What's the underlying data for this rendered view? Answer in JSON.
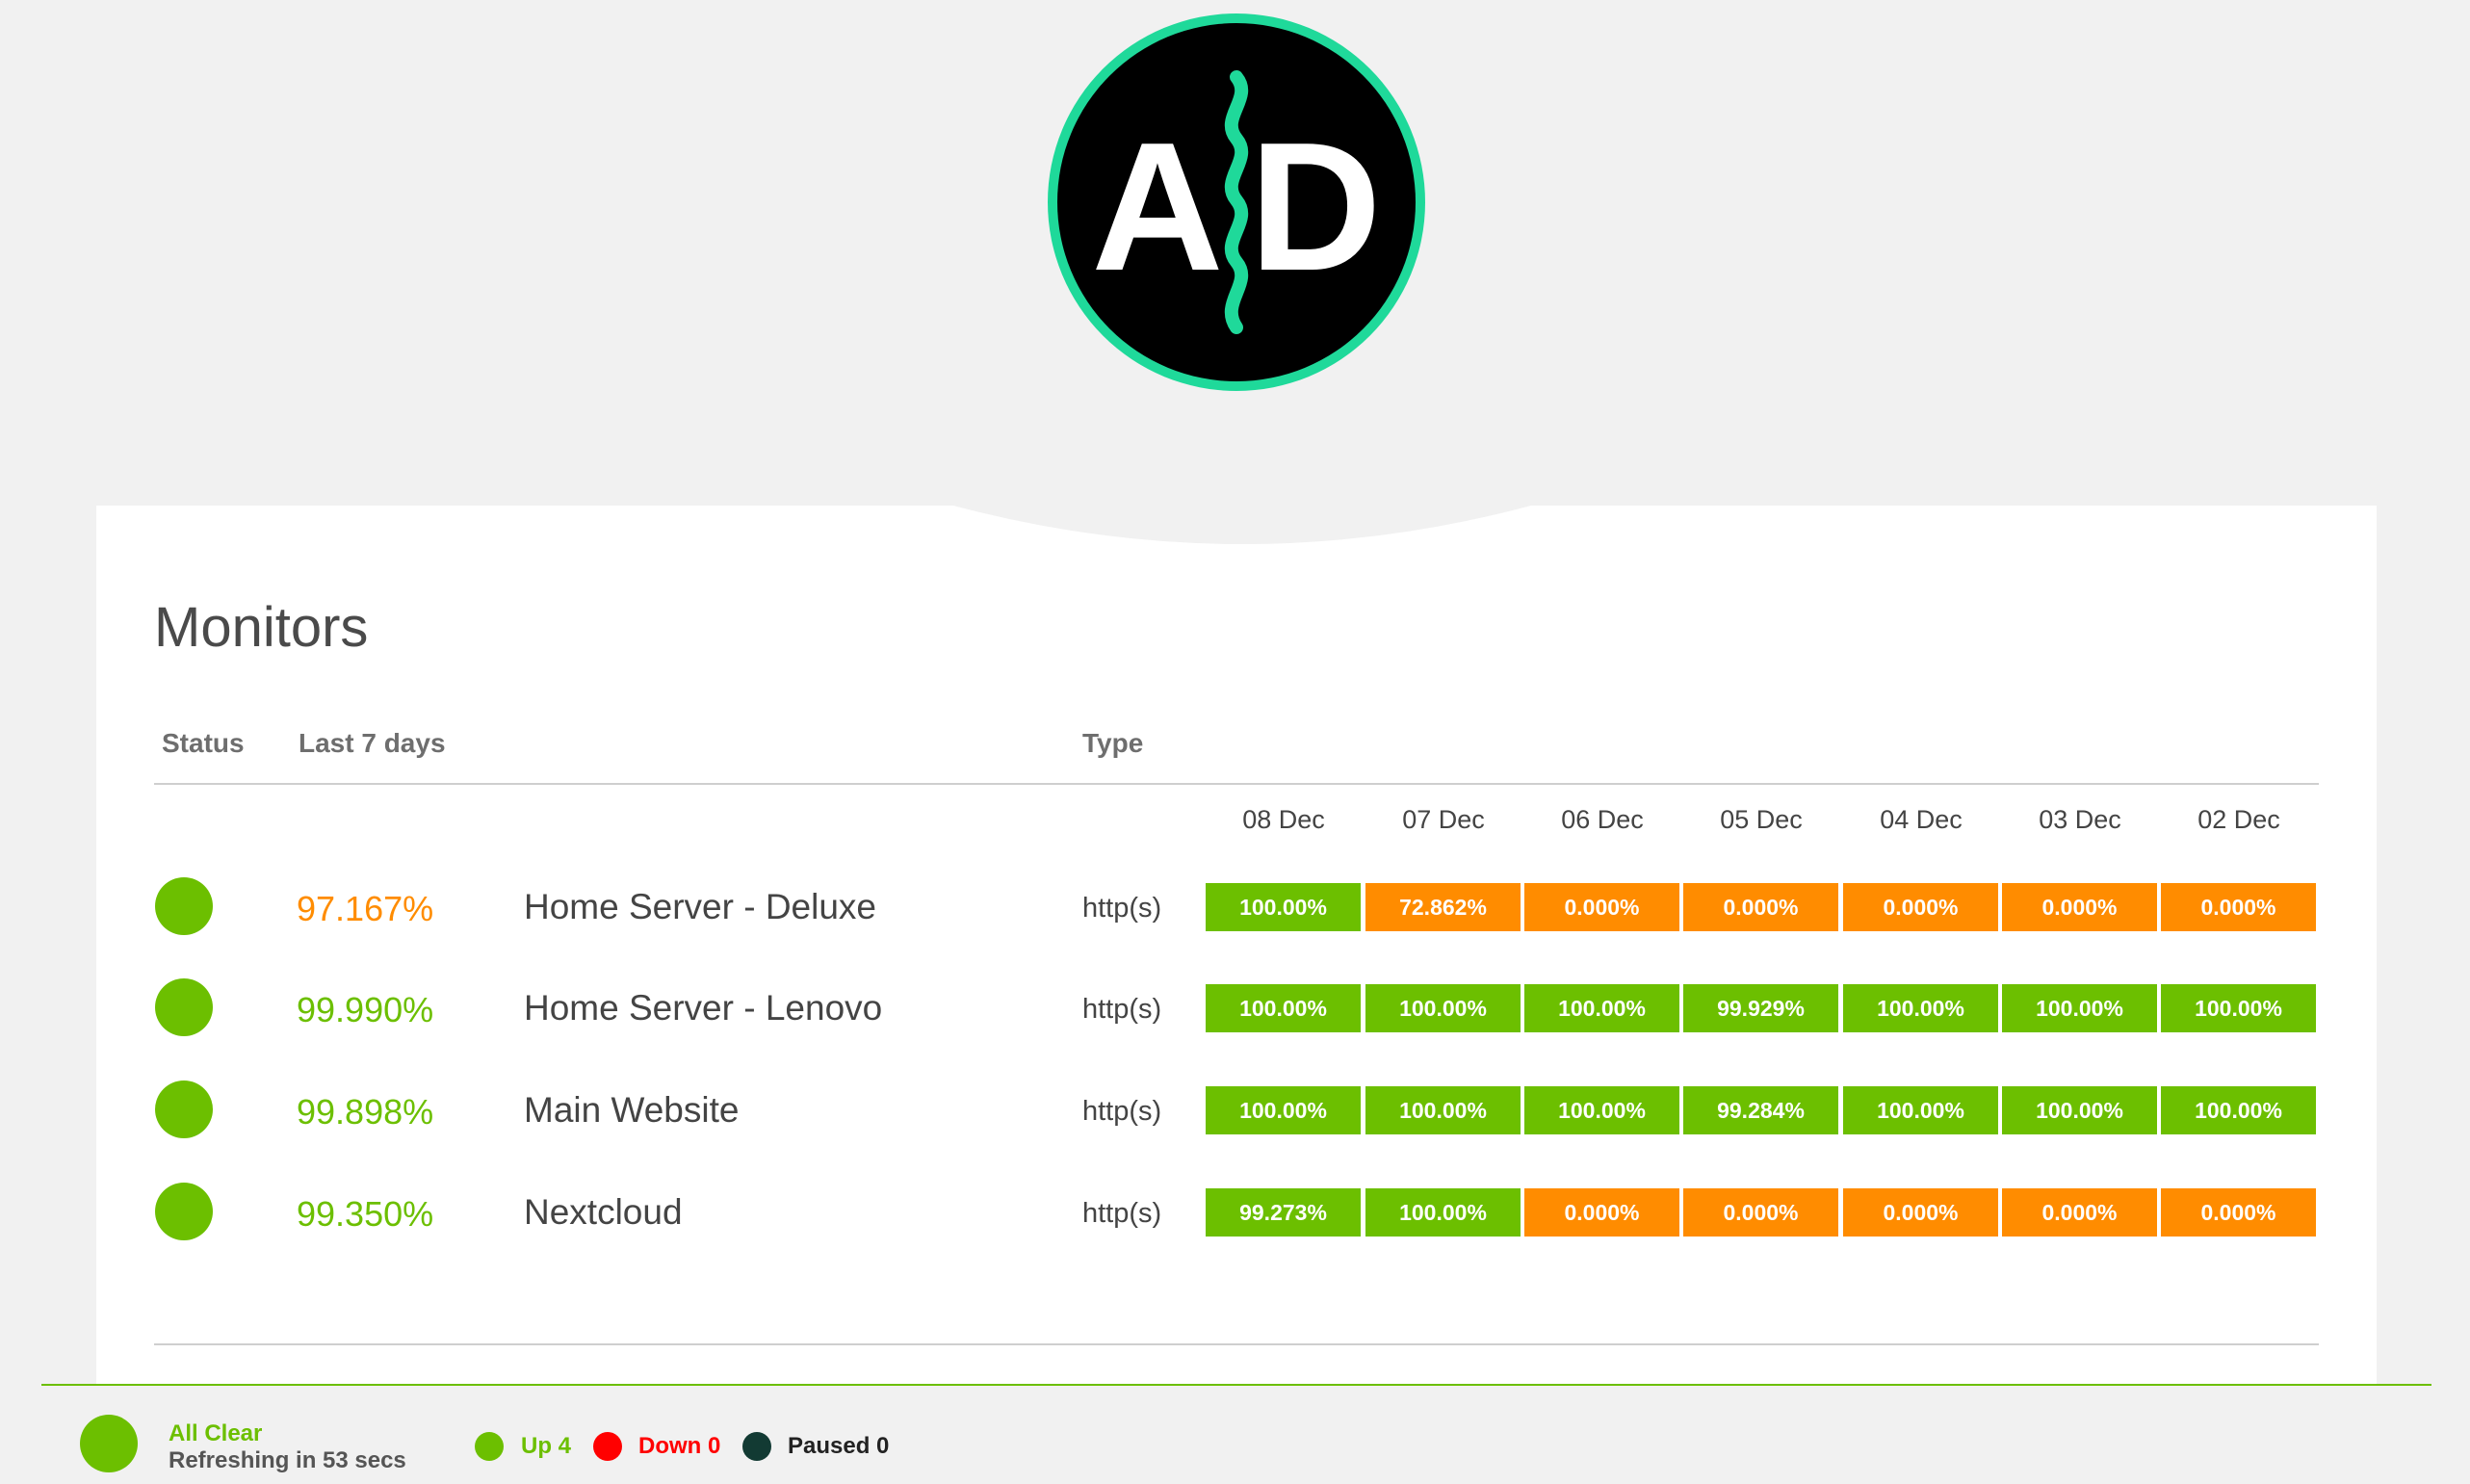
{
  "logo": {
    "text_left": "A",
    "text_right": "D",
    "ring_color": "#1fd99a",
    "bg_color": "#000000"
  },
  "colors": {
    "up": "#6cbf00",
    "warn": "#ff8c00",
    "down": "#ff0000",
    "paused": "#123a33"
  },
  "page_title": "Monitors",
  "table": {
    "headers": {
      "status": "Status",
      "last7": "Last 7 days",
      "type": "Type"
    },
    "dates": [
      "08 Dec",
      "07 Dec",
      "06 Dec",
      "05 Dec",
      "04 Dec",
      "03 Dec",
      "02 Dec"
    ],
    "rows": [
      {
        "status": "up",
        "uptime": "97.167%",
        "uptime_color": "#ff8c00",
        "name": "Home Server - Deluxe",
        "type": "http(s)",
        "days": [
          {
            "value": "100.00%",
            "status": "green"
          },
          {
            "value": "72.862%",
            "status": "orange"
          },
          {
            "value": "0.000%",
            "status": "orange"
          },
          {
            "value": "0.000%",
            "status": "orange"
          },
          {
            "value": "0.000%",
            "status": "orange"
          },
          {
            "value": "0.000%",
            "status": "orange"
          },
          {
            "value": "0.000%",
            "status": "orange"
          }
        ]
      },
      {
        "status": "up",
        "uptime": "99.990%",
        "uptime_color": "#6cbf00",
        "name": "Home Server - Lenovo",
        "type": "http(s)",
        "days": [
          {
            "value": "100.00%",
            "status": "green"
          },
          {
            "value": "100.00%",
            "status": "green"
          },
          {
            "value": "100.00%",
            "status": "green"
          },
          {
            "value": "99.929%",
            "status": "green"
          },
          {
            "value": "100.00%",
            "status": "green"
          },
          {
            "value": "100.00%",
            "status": "green"
          },
          {
            "value": "100.00%",
            "status": "green"
          }
        ]
      },
      {
        "status": "up",
        "uptime": "99.898%",
        "uptime_color": "#6cbf00",
        "name": "Main Website",
        "type": "http(s)",
        "days": [
          {
            "value": "100.00%",
            "status": "green"
          },
          {
            "value": "100.00%",
            "status": "green"
          },
          {
            "value": "100.00%",
            "status": "green"
          },
          {
            "value": "99.284%",
            "status": "green"
          },
          {
            "value": "100.00%",
            "status": "green"
          },
          {
            "value": "100.00%",
            "status": "green"
          },
          {
            "value": "100.00%",
            "status": "green"
          }
        ]
      },
      {
        "status": "up",
        "uptime": "99.350%",
        "uptime_color": "#6cbf00",
        "name": "Nextcloud",
        "type": "http(s)",
        "days": [
          {
            "value": "99.273%",
            "status": "green"
          },
          {
            "value": "100.00%",
            "status": "green"
          },
          {
            "value": "0.000%",
            "status": "orange"
          },
          {
            "value": "0.000%",
            "status": "orange"
          },
          {
            "value": "0.000%",
            "status": "orange"
          },
          {
            "value": "0.000%",
            "status": "orange"
          },
          {
            "value": "0.000%",
            "status": "orange"
          }
        ]
      }
    ]
  },
  "footer": {
    "overall": "All Clear",
    "refresh": "Refreshing in 53 secs",
    "legend": [
      {
        "label": "Up 4",
        "color": "#6cbf00"
      },
      {
        "label": "Down 0",
        "color": "#ff0000"
      },
      {
        "label": "Paused 0",
        "color": "#123a33"
      }
    ]
  }
}
